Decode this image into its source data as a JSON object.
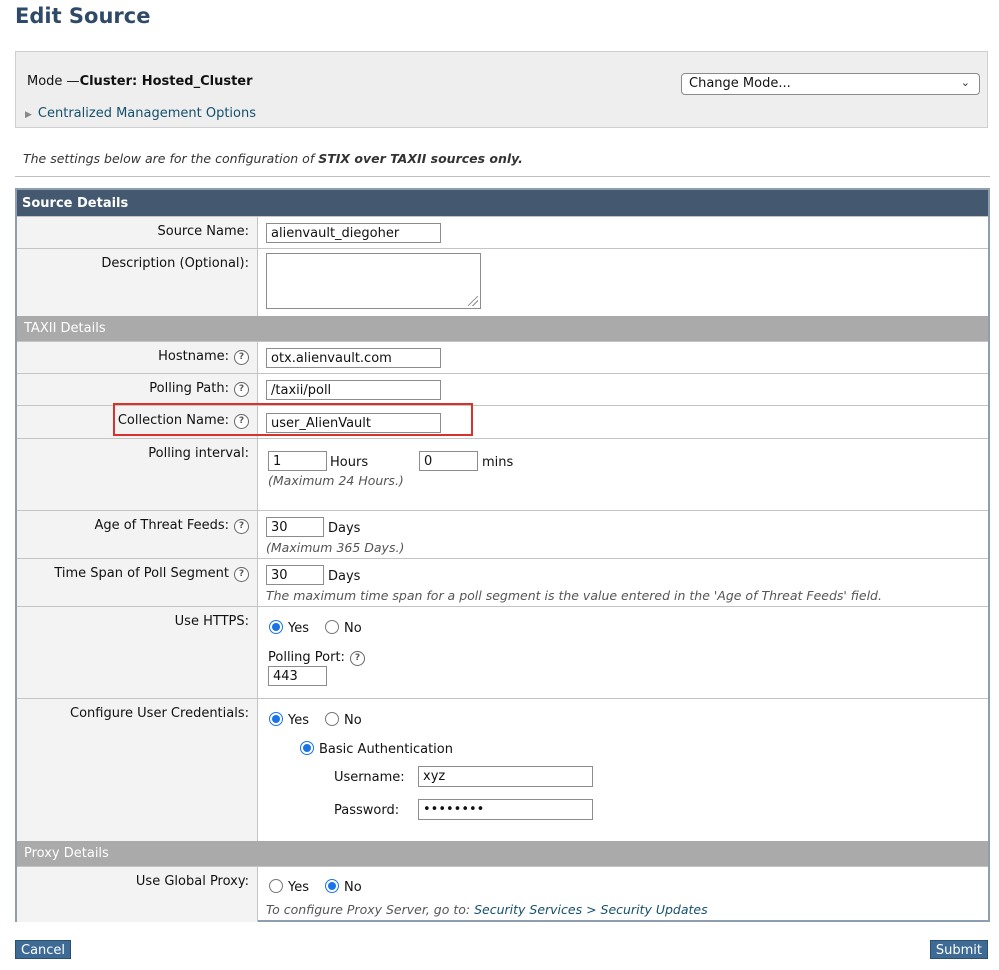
{
  "page_title": "Edit Source",
  "mode": {
    "prefix": "Mode —",
    "value": "Cluster: Hosted_Cluster",
    "select_value": "Change Mode...",
    "centralized_link": "Centralized Management Options"
  },
  "note": {
    "text": "The settings below are for the configuration of ",
    "bold": "STIX over TAXII sources only."
  },
  "source_details": {
    "header": "Source Details",
    "source_name_label": "Source Name:",
    "source_name_value": "alienvault_diegoher",
    "description_label": "Description (Optional):",
    "description_value": ""
  },
  "taxii": {
    "header": "TAXII Details",
    "hostname_label": "Hostname:",
    "hostname_value": "otx.alienvault.com",
    "polling_path_label": "Polling Path:",
    "polling_path_value": "/taxii/poll",
    "collection_label": "Collection Name:",
    "collection_value": "user_AlienVault",
    "interval_label": "Polling interval:",
    "interval_hours": "1",
    "hours_unit": "Hours",
    "interval_mins": "0",
    "mins_unit": "mins",
    "interval_hint": "(Maximum 24 Hours.)",
    "age_label": "Age of Threat Feeds:",
    "age_value": "30",
    "age_unit": "Days",
    "age_hint": "(Maximum 365 Days.)",
    "span_label": "Time Span of Poll Segment",
    "span_value": "30",
    "span_unit": "Days",
    "span_hint": "The maximum time span for a poll segment is the value entered in the 'Age of Threat Feeds' field.",
    "https_label": "Use HTTPS:",
    "https_yes": "Yes",
    "https_no": "No",
    "https_selected": "Yes",
    "port_label": "Polling Port:",
    "port_value": "443",
    "creds_label": "Configure User Credentials:",
    "creds_yes": "Yes",
    "creds_no": "No",
    "creds_selected": "Yes",
    "basic_auth": "Basic Authentication",
    "username_label": "Username:",
    "username_value": "xyz",
    "password_label": "Password:",
    "password_value": "••••••••"
  },
  "proxy": {
    "header": "Proxy Details",
    "global_label": "Use Global Proxy:",
    "yes": "Yes",
    "no": "No",
    "selected": "No",
    "hint_prefix": "To configure Proxy Server, go to: ",
    "hint_link": "Security Services > Security Updates"
  },
  "buttons": {
    "cancel": "Cancel",
    "submit": "Submit"
  }
}
